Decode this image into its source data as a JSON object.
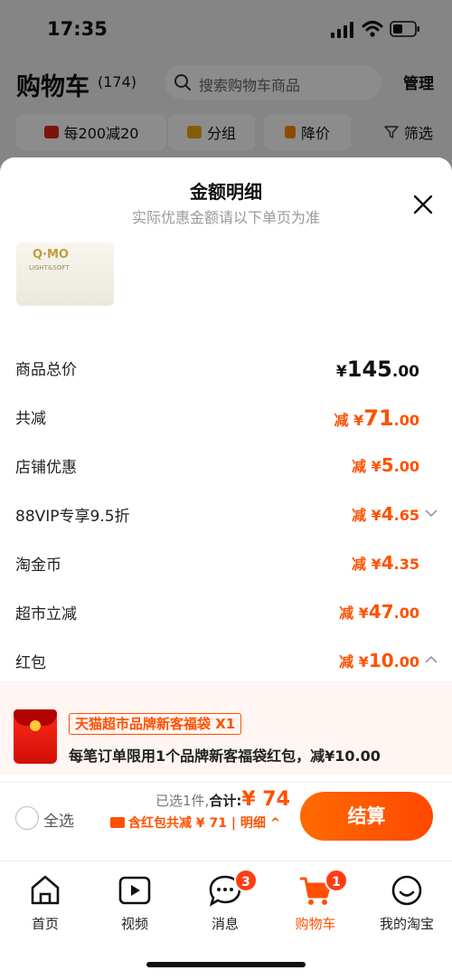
{
  "status_bar": {
    "time": "17:35"
  },
  "cart_header": {
    "title": "购物车",
    "count": "(174)",
    "search_placeholder": "搜索购物车商品",
    "manage": "管理"
  },
  "filters": [
    {
      "label": "每200减20"
    },
    {
      "label": "分组"
    },
    {
      "label": "降价"
    },
    {
      "label": "筛选"
    }
  ],
  "sheet": {
    "title": "金额明细",
    "subtitle": "实际优惠金额请以下单页为准",
    "product_brand": "Q·MO",
    "product_text": "LIGHT&SOFT"
  },
  "breakdown": [
    {
      "label": "商品总价",
      "prefix": "¥",
      "int": "145",
      "dec": ".00"
    },
    {
      "label": "共减",
      "prefix": "减 ¥",
      "int": "71",
      "dec": ".00"
    },
    {
      "label": "店铺优惠",
      "prefix": "减 ¥",
      "int": "5",
      "dec": ".00"
    },
    {
      "label": "88VIP专享9.5折",
      "prefix": "减 ¥",
      "int": "4",
      "dec": ".65"
    },
    {
      "label": "淘金币",
      "prefix": "减 ¥",
      "int": "4",
      "dec": ".35"
    },
    {
      "label": "超市立减",
      "prefix": "减 ¥",
      "int": "47",
      "dec": ".00"
    },
    {
      "label": "红包",
      "prefix": "减 ¥",
      "int": "10",
      "dec": ".00"
    }
  ],
  "coupon": {
    "tag": "天猫超市品牌新客福袋 X1",
    "desc": "每笔订单限用1个品牌新客福袋红包，减¥10.00"
  },
  "footer": {
    "select_all": "全选",
    "selected_count": "已选1件,",
    "total_label": "合计:",
    "total_amount": "¥ 74",
    "savings": "含红包共减 ¥ 71",
    "detail": "明细",
    "checkout": "结算"
  },
  "tabs": [
    {
      "label": "首页",
      "icon": "home-icon"
    },
    {
      "label": "视频",
      "icon": "video-icon"
    },
    {
      "label": "消息",
      "icon": "message-icon",
      "badge": "3"
    },
    {
      "label": "购物车",
      "icon": "cart-icon",
      "badge": "1"
    },
    {
      "label": "我的淘宝",
      "icon": "profile-icon"
    }
  ],
  "colors": {
    "accent": "#ff5000",
    "badge": "#ff3d14"
  }
}
